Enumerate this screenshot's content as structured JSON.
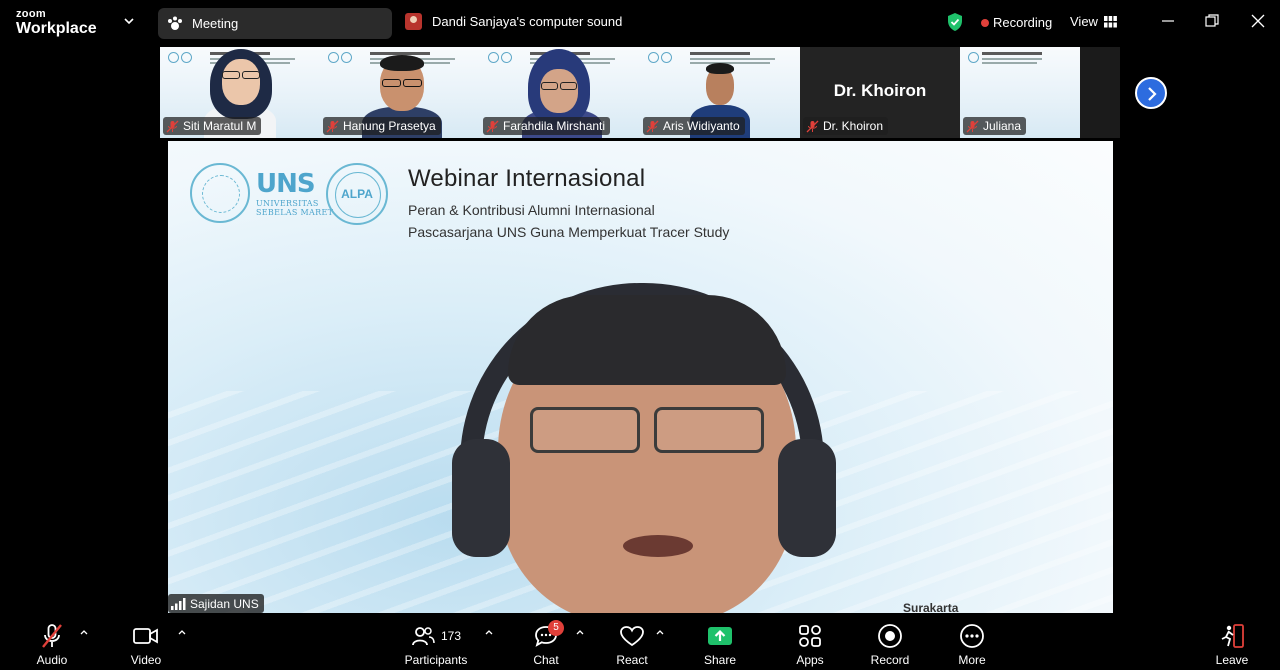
{
  "app": {
    "brand_top": "zoom",
    "brand_bottom": "Workplace"
  },
  "titlebar": {
    "meeting_label": "Meeting",
    "sound_share": "Dandi Sanjaya's computer sound",
    "recording_label": "Recording",
    "view_label": "View"
  },
  "thumbnails": [
    {
      "name": "Siti Maratul M",
      "muted": true
    },
    {
      "name": "Hanung Prasetya",
      "muted": true
    },
    {
      "name": "Farahdila Mirshanti",
      "muted": true
    },
    {
      "name": "Aris Widiyanto",
      "muted": true
    },
    {
      "name": "Dr. Khoiron",
      "muted": true,
      "video_off": true
    },
    {
      "name": "Juliana",
      "muted": true
    }
  ],
  "main_video": {
    "speaker_name": "Sajidan UNS",
    "slide": {
      "logo_text": "UNS",
      "logo_subtext_1": "UNIVERSITAS",
      "logo_subtext_2": "SEBELAS MARET",
      "alpa_text": "ALPA",
      "title": "Webinar Internasional",
      "subtitle_1": "Peran & Kontribusi Alumni Internasional",
      "subtitle_2": "Pascasarjana UNS Guna Memperkuat Tracer Study",
      "location": "Surakarta"
    }
  },
  "toolbar": {
    "audio": "Audio",
    "video": "Video",
    "participants": "Participants",
    "participants_count": "173",
    "chat": "Chat",
    "chat_badge": "5",
    "react": "React",
    "share": "Share",
    "apps": "Apps",
    "record": "Record",
    "more": "More",
    "leave": "Leave"
  },
  "colors": {
    "accent_blue": "#2d6cdf",
    "share_green": "#1fc16b",
    "recording_red": "#e0403a",
    "shield_green": "#1fc16b"
  }
}
